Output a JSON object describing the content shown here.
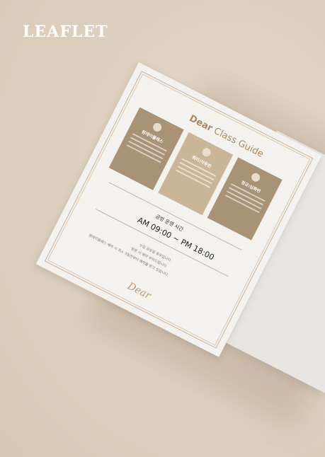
{
  "header": {
    "title": "LEAFLET"
  },
  "leaflet": {
    "guide_title_brand": "Dear",
    "guide_title_rest": " Class Guide",
    "cards": [
      {
        "title": "원데이클래스",
        "icon": "flower-icon"
      },
      {
        "title": "취미/자유반",
        "icon": "flower-icon"
      },
      {
        "title": "정규/심화반",
        "icon": "flower-icon"
      }
    ],
    "hours_label": "공방 운영 시간",
    "hours": "AM 09:00 ~ PM 18:00",
    "note_1": "수업 공휴일 휴무입니다.",
    "note_2": "방문 시 예약 부탁드립니다.",
    "note_3": "원데이클래스 예약 시 최소 3일전부터 예약을 받고 있습니다.",
    "signature": "Dear"
  },
  "colors": {
    "background": "#dfd1c1",
    "accent": "#a88a62",
    "card": "#a99377"
  }
}
